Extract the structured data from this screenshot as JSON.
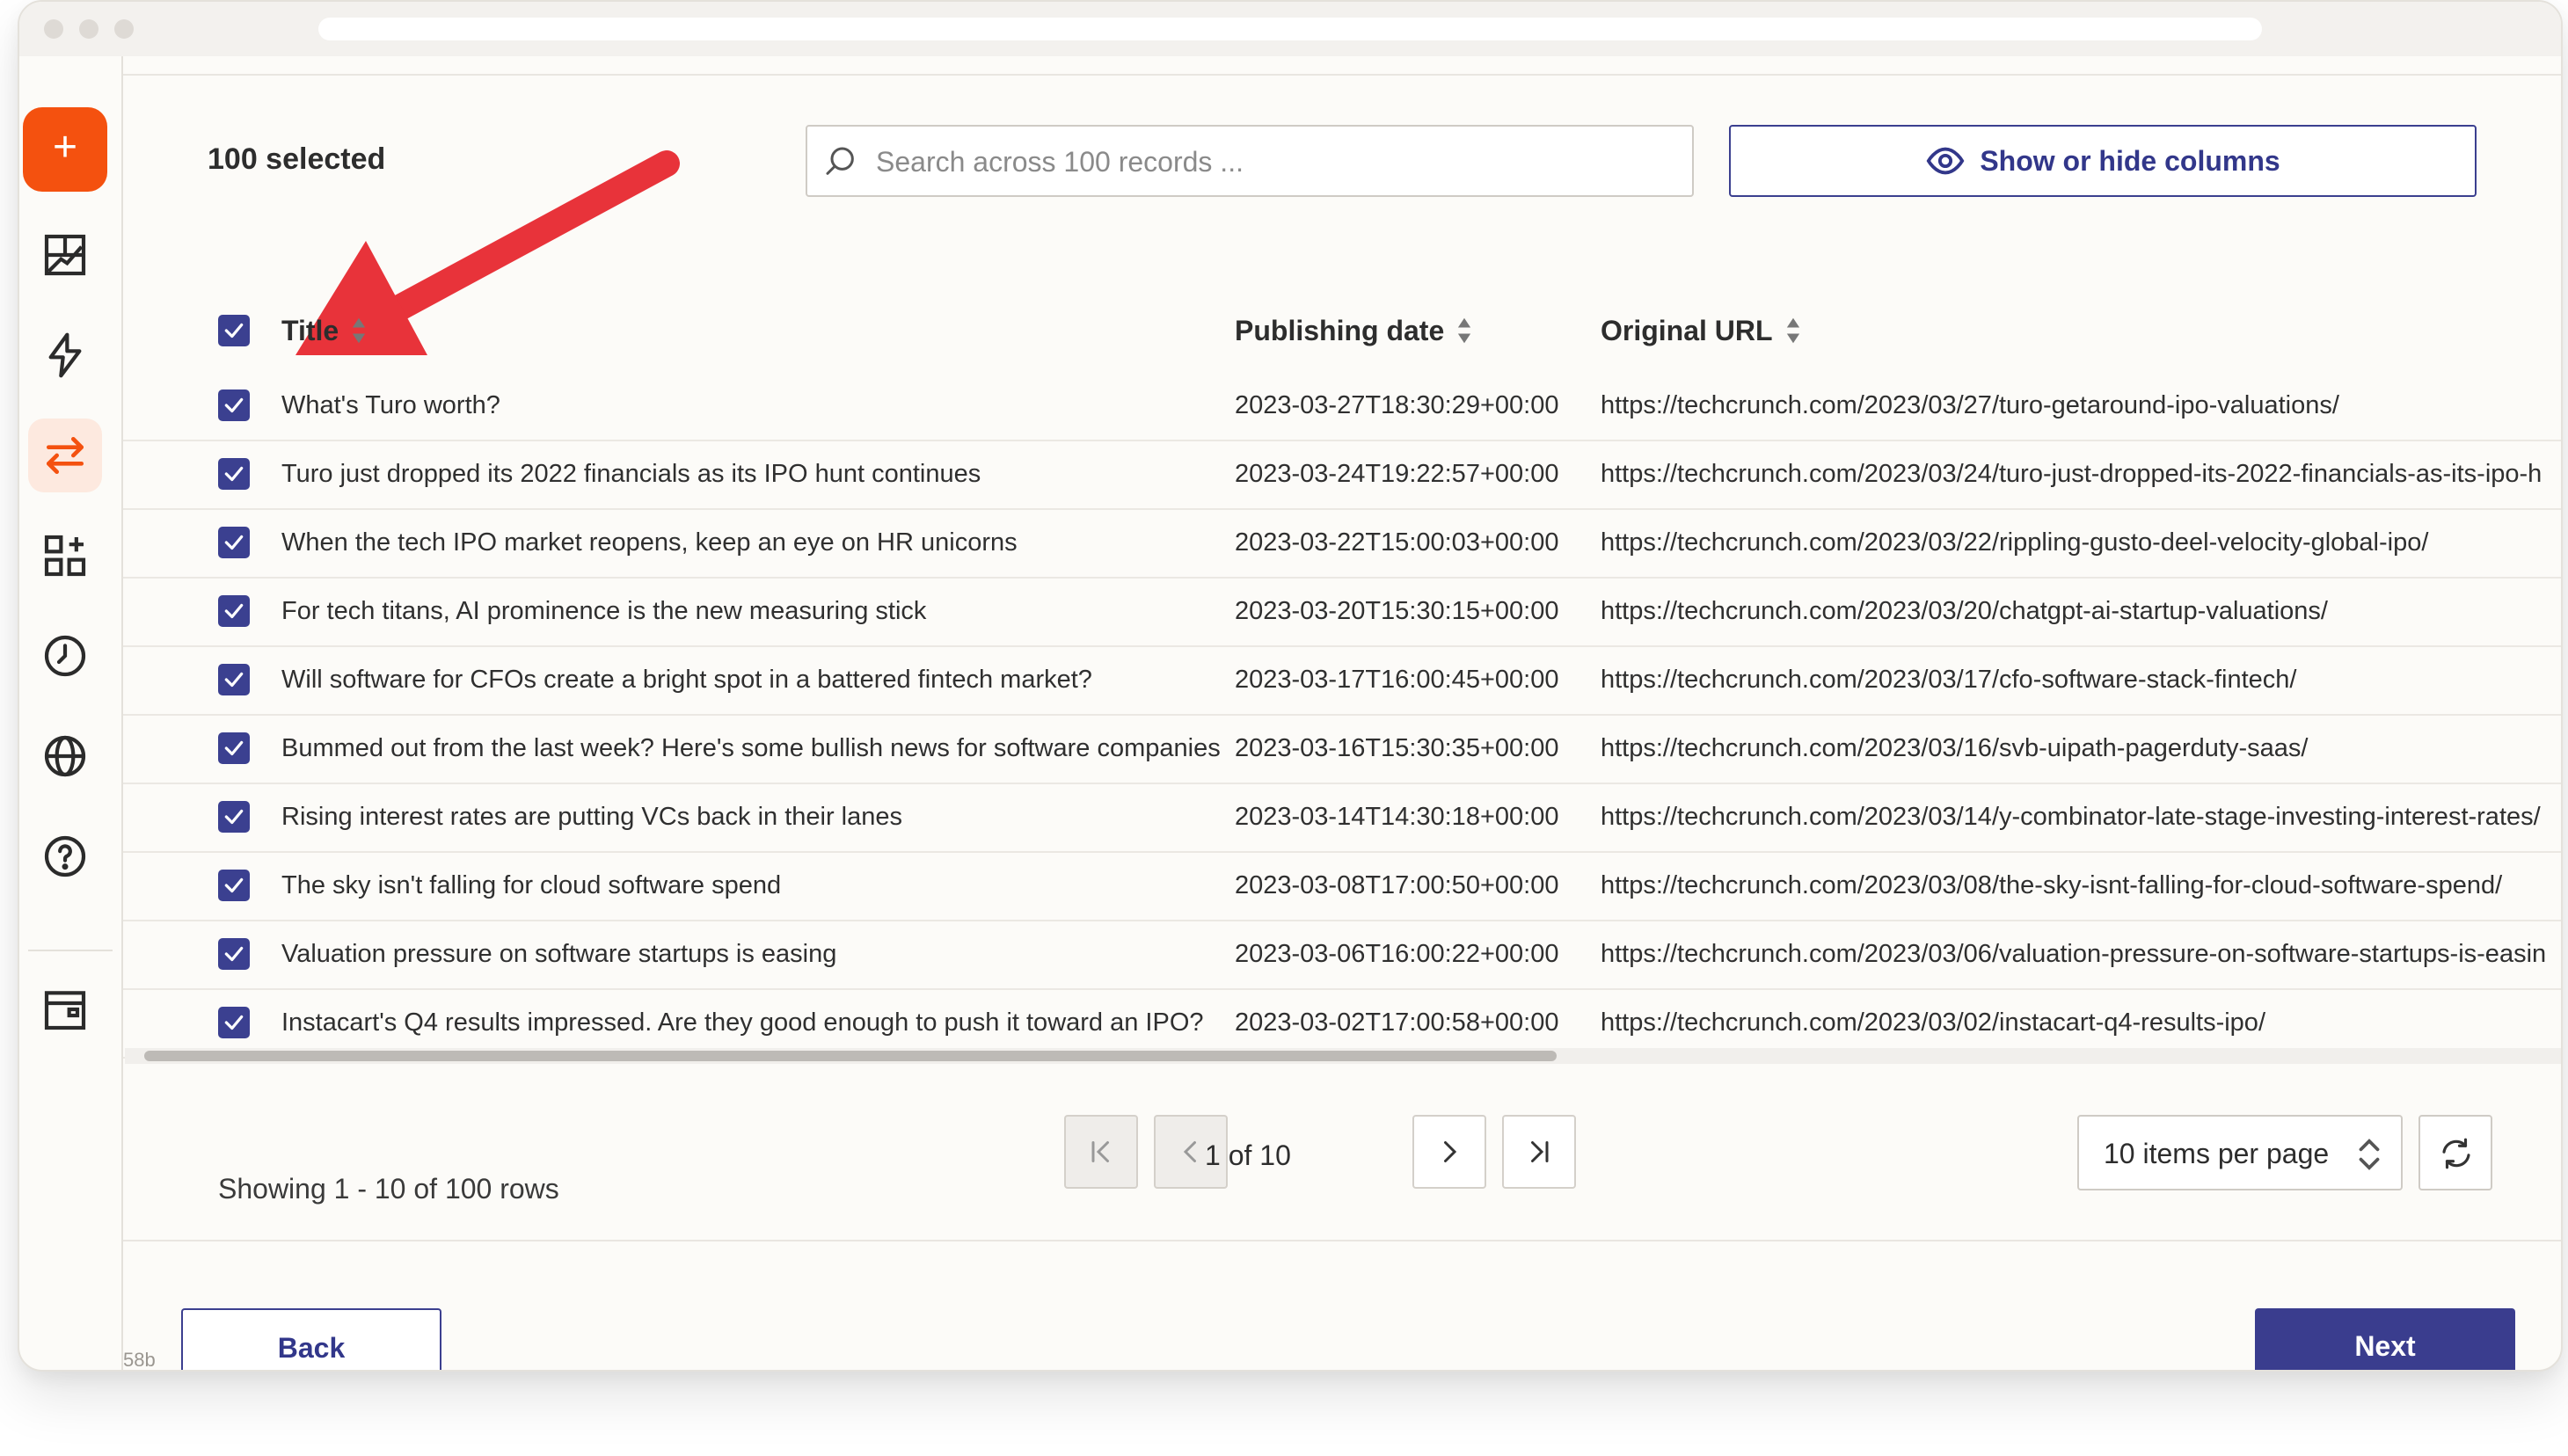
{
  "selected_count_text": "100 selected",
  "search": {
    "placeholder": "Search across 100 records ..."
  },
  "columns_button": {
    "label": "Show or hide columns",
    "icon": "eye-icon"
  },
  "table": {
    "headers": {
      "title": "Title",
      "date": "Publishing date",
      "url": "Original URL"
    },
    "rows": [
      {
        "title": "What's Turo worth?",
        "date": "2023-03-27T18:30:29+00:00",
        "url": "https://techcrunch.com/2023/03/27/turo-getaround-ipo-valuations/"
      },
      {
        "title": "Turo just dropped its 2022 financials as its IPO hunt continues",
        "date": "2023-03-24T19:22:57+00:00",
        "url": "https://techcrunch.com/2023/03/24/turo-just-dropped-its-2022-financials-as-its-ipo-h"
      },
      {
        "title": "When the tech IPO market reopens, keep an eye on HR unicorns",
        "date": "2023-03-22T15:00:03+00:00",
        "url": "https://techcrunch.com/2023/03/22/rippling-gusto-deel-velocity-global-ipo/"
      },
      {
        "title": "For tech titans, AI prominence is the new measuring stick",
        "date": "2023-03-20T15:30:15+00:00",
        "url": "https://techcrunch.com/2023/03/20/chatgpt-ai-startup-valuations/"
      },
      {
        "title": "Will software for CFOs create a bright spot in a battered fintech market?",
        "date": "2023-03-17T16:00:45+00:00",
        "url": "https://techcrunch.com/2023/03/17/cfo-software-stack-fintech/"
      },
      {
        "title": "Bummed out from the last week? Here's some bullish news for software companies",
        "date": "2023-03-16T15:30:35+00:00",
        "url": "https://techcrunch.com/2023/03/16/svb-uipath-pagerduty-saas/"
      },
      {
        "title": "Rising interest rates are putting VCs back in their lanes",
        "date": "2023-03-14T14:30:18+00:00",
        "url": "https://techcrunch.com/2023/03/14/y-combinator-late-stage-investing-interest-rates/"
      },
      {
        "title": "The sky isn't falling for cloud software spend",
        "date": "2023-03-08T17:00:50+00:00",
        "url": "https://techcrunch.com/2023/03/08/the-sky-isnt-falling-for-cloud-software-spend/"
      },
      {
        "title": "Valuation pressure on software startups is easing",
        "date": "2023-03-06T16:00:22+00:00",
        "url": "https://techcrunch.com/2023/03/06/valuation-pressure-on-software-startups-is-easin"
      },
      {
        "title": "Instacart's Q4 results impressed. Are they good enough to push it toward an IPO?",
        "date": "2023-03-02T17:00:58+00:00",
        "url": "https://techcrunch.com/2023/03/02/instacart-q4-results-ipo/"
      }
    ]
  },
  "pagination": {
    "showing_text": "Showing 1 - 10 of 100 rows",
    "page_label": "1 of 10",
    "per_page_label": "10 items per page"
  },
  "footer": {
    "back_label": "Back",
    "next_label": "Next",
    "corner_text": "58b"
  },
  "sidebar": {
    "items": [
      "dashboard-icon",
      "lightning-icon",
      "transfer-icon",
      "apps-icon",
      "clock-icon",
      "globe-icon",
      "help-icon",
      "window-icon"
    ],
    "active": "transfer-icon"
  },
  "colors": {
    "accent": "#f4510f",
    "primary": "#3a3d8e",
    "annotation_arrow": "#e8333a"
  }
}
